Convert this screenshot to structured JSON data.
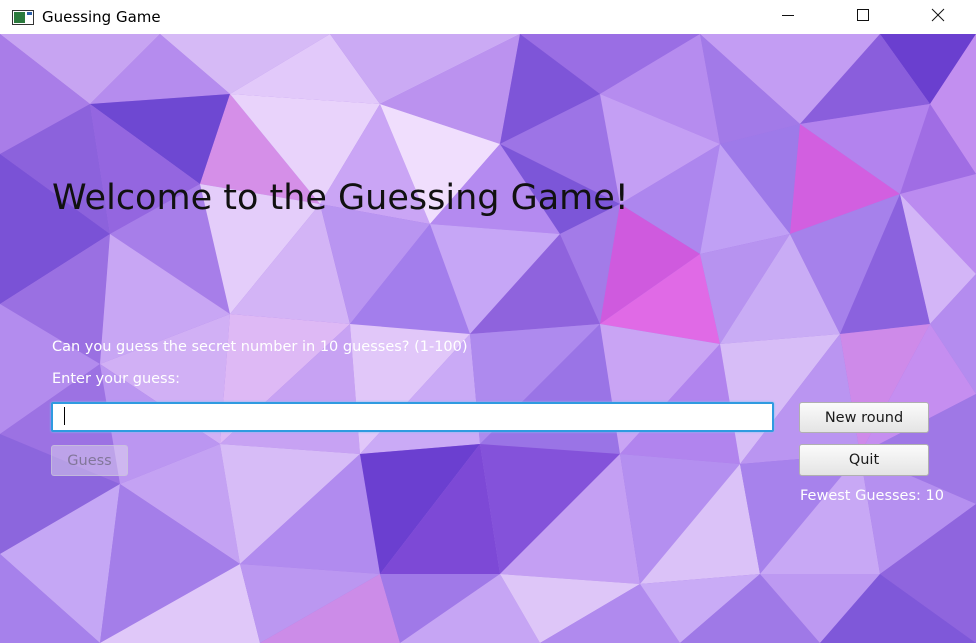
{
  "window": {
    "title": "Guessing Game",
    "controls": {
      "minimize_icon": "minimize-icon",
      "maximize_icon": "maximize-icon",
      "close_icon": "close-icon"
    }
  },
  "main": {
    "welcome": "Welcome to the Guessing Game!",
    "question": "Can you guess the secret number in 10 guesses? (1-100)",
    "enter_label": "Enter your guess:",
    "guess_input": {
      "value": "",
      "placeholder": ""
    },
    "guess_button": "Guess",
    "new_round_button": "New round",
    "quit_button": "Quit",
    "fewest_guesses": "Fewest Guesses: 10"
  },
  "colors": {
    "background_base": "#a070e0",
    "accent_focus": "#2f9be0",
    "text_light": "#ffffff"
  }
}
